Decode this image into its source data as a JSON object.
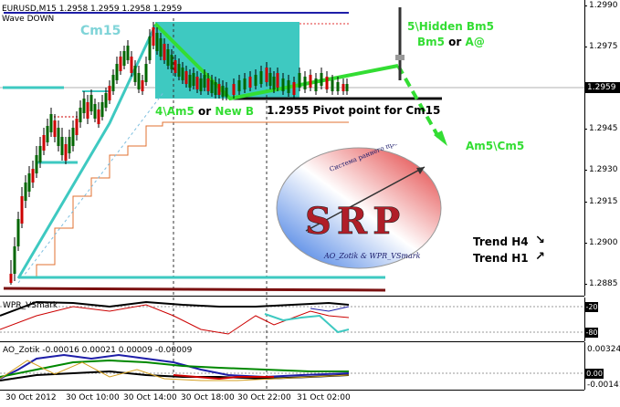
{
  "main_panel": {
    "symbol_line": "EURUSD,M15  1.2958 1.2959 1.2958 1.2959",
    "indicator_line": "Wave DOWN",
    "price_ticks": [
      "1.2990",
      "1.2975",
      "1.2960",
      "1.2945",
      "1.2930",
      "1.2915",
      "1.2900",
      "1.2885"
    ],
    "current_price": "1.2959"
  },
  "annotations": {
    "cm15": "Cm15",
    "hidden_bm5": "5\\Hidden Bm5",
    "bm5_or_a": "Bm5 or A@",
    "am5_new_b": "4\\Am5 or New B",
    "pivot": "1.2955 Pivot point for Cm15",
    "am5_cm5": "Am5\\Cm5",
    "trend_h4": "Trend H4",
    "trend_h1": "Trend H1"
  },
  "logo": {
    "arc_text": "Система раннего прогнозирования",
    "letters": "SRP",
    "bottom_text": "AO_Zotik & WPR_VSmark"
  },
  "wpr_panel": {
    "label": "WPR_VSmark",
    "ticks": [
      "-20",
      "-80"
    ]
  },
  "ao_panel": {
    "label": "AO_Zotik  -0.00016  0.00021  0.00009  -0.00009",
    "ticks": [
      "0.00324",
      "0.00",
      "-0.00141"
    ]
  },
  "time_axis": [
    "30 Oct 2012",
    "30 Oct 10:00",
    "30 Oct 14:00",
    "30 Oct 18:00",
    "30 Oct 22:00",
    "31 Oct 02:00"
  ],
  "colors": {
    "accent_cyan": "#3ec9c1",
    "bright_green": "#33dd33",
    "candle": "#009900",
    "candle_bear": "#cc0000"
  }
}
